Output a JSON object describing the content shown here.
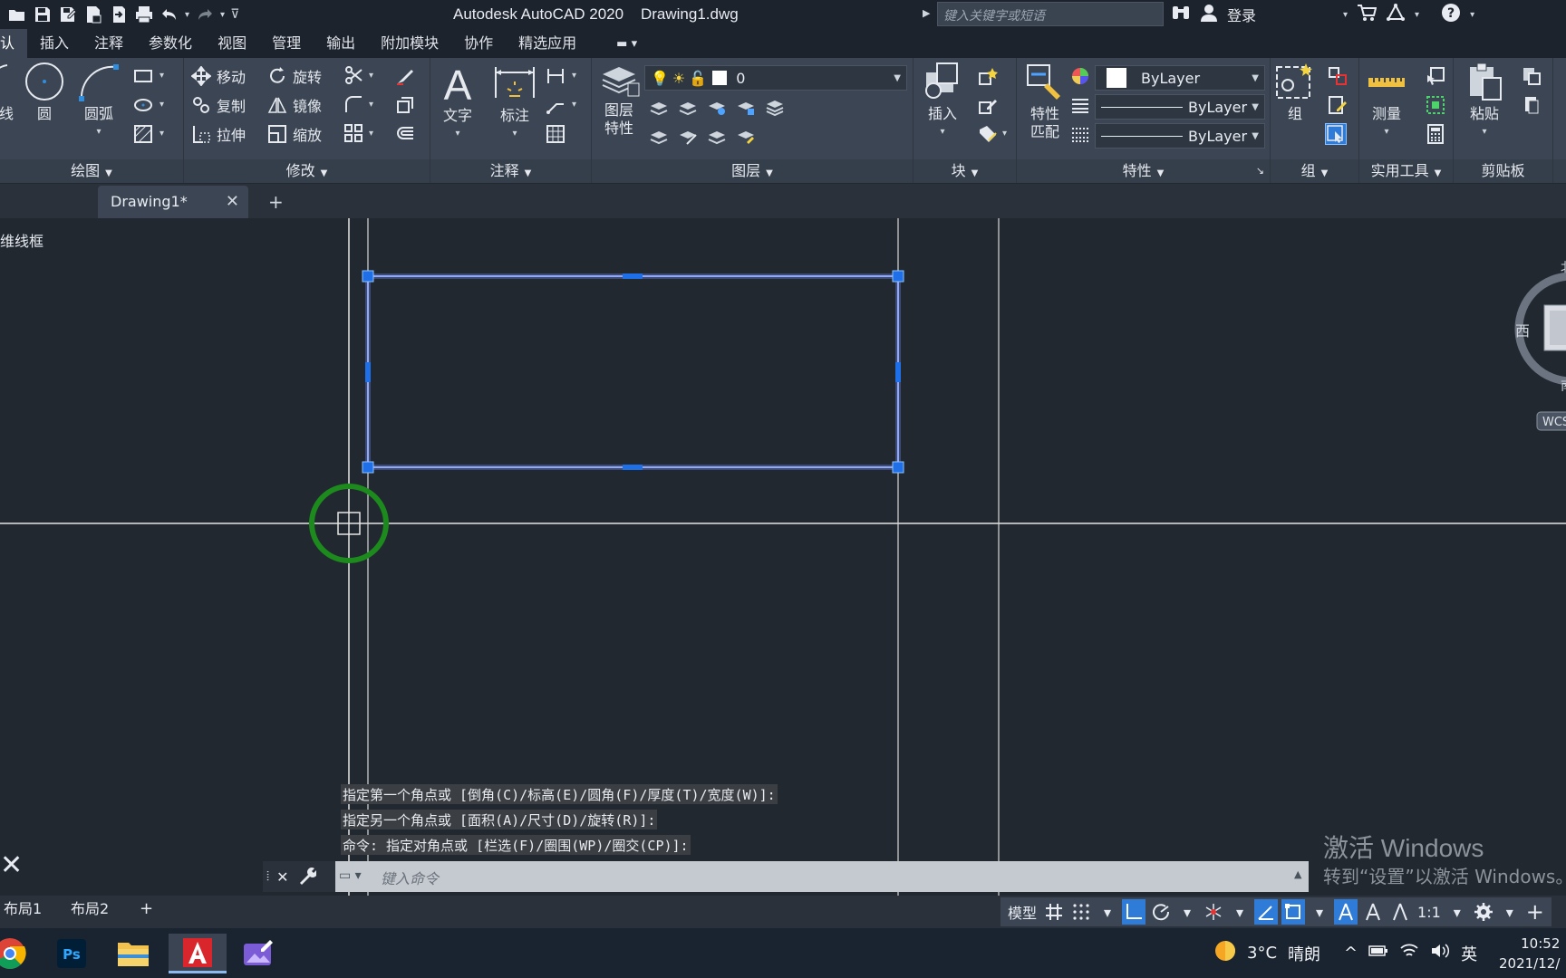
{
  "title": "Autodesk AutoCAD 2020    Drawing1.dwg",
  "search": {
    "placeholder": "键入关键字或短语"
  },
  "account": {
    "login_label": "登录"
  },
  "ribbon_tabs": [
    {
      "label": "认"
    },
    {
      "label": "插入"
    },
    {
      "label": "注释"
    },
    {
      "label": "参数化"
    },
    {
      "label": "视图"
    },
    {
      "label": "管理"
    },
    {
      "label": "输出"
    },
    {
      "label": "附加模块"
    },
    {
      "label": "协作"
    },
    {
      "label": "精选应用"
    }
  ],
  "draw_panel": {
    "title": "绘图",
    "line": "线",
    "circle": "圆",
    "arc": "圆弧"
  },
  "modify_panel": {
    "title": "修改",
    "move": "移动",
    "rotate": "旋转",
    "copy": "复制",
    "mirror": "镜像",
    "stretch": "拉伸",
    "scale": "缩放"
  },
  "annotation_panel": {
    "title": "注释",
    "text": "文字",
    "dimension": "标注"
  },
  "layers_panel": {
    "title": "图层",
    "layer_props_1": "图层",
    "layer_props_2": "特性",
    "current_layer": "0"
  },
  "block_panel": {
    "title": "块",
    "insert": "插入"
  },
  "properties_panel": {
    "title": "特性",
    "match_1": "特性",
    "match_2": "匹配",
    "color": "ByLayer",
    "linetype": "ByLayer",
    "lineweight": "ByLayer"
  },
  "groups_panel": {
    "title": "组",
    "group": "组"
  },
  "utilities_panel": {
    "title": "实用工具",
    "measure": "测量"
  },
  "clipboard_panel": {
    "title": "剪贴板",
    "paste": "粘贴"
  },
  "doc_tab": {
    "label": "Drawing1*"
  },
  "view_label": "维线框",
  "viewcube": {
    "north": "北",
    "west": "西",
    "south": "南",
    "wcs": "WCS"
  },
  "command_history": [
    "指定第一个角点或 [倒角(C)/标高(E)/圆角(F)/厚度(T)/宽度(W)]:",
    "指定另一个角点或 [面积(A)/尺寸(D)/旋转(R)]:",
    "命令: 指定对角点或 [栏选(F)/圈围(WP)/圈交(CP)]:"
  ],
  "command_input": {
    "placeholder": "键入命令"
  },
  "layout_tabs": [
    {
      "label": "布局1"
    },
    {
      "label": "布局2"
    }
  ],
  "status": {
    "model": "模型",
    "scale": "1:1"
  },
  "watermark": {
    "line1": "激活 Windows",
    "line2": "转到“设置”以激活 Windows。"
  },
  "taskbar": {
    "temperature": "3°C",
    "weather": "晴朗",
    "ime": "英",
    "time": "10:52",
    "date": "2021/12/"
  },
  "colors": {
    "selection": "#4d6fe6",
    "grip": "#1e6fe8",
    "crosshair": "#e6e6e6",
    "snap_marker": "#1d8a1d",
    "ribbon": "#3b4553",
    "canvas": "#212830"
  }
}
